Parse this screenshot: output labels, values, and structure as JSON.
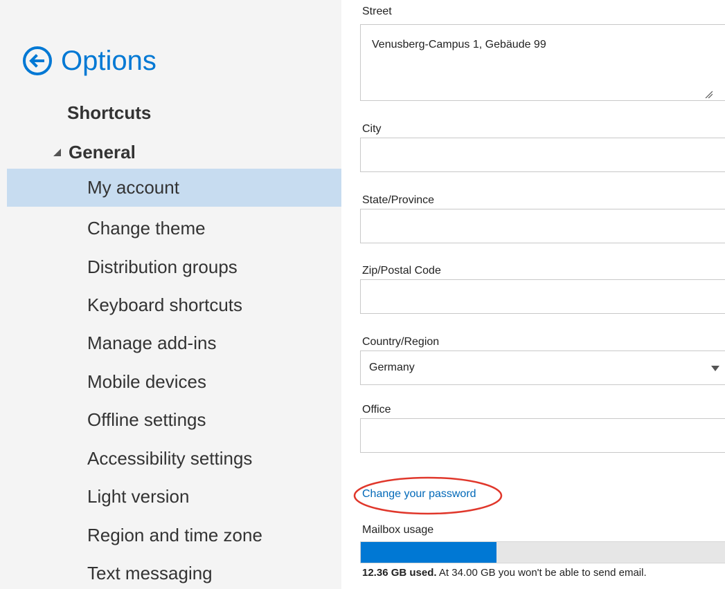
{
  "sidebar": {
    "title": "Options",
    "shortcuts": "Shortcuts",
    "general": "General",
    "items": [
      {
        "label": "My account",
        "selected": true
      },
      {
        "label": "Change theme"
      },
      {
        "label": "Distribution groups"
      },
      {
        "label": "Keyboard shortcuts"
      },
      {
        "label": "Manage add-ins"
      },
      {
        "label": "Mobile devices"
      },
      {
        "label": "Offline settings"
      },
      {
        "label": "Accessibility settings"
      },
      {
        "label": "Light version"
      },
      {
        "label": "Region and time zone"
      },
      {
        "label": "Text messaging"
      }
    ]
  },
  "form": {
    "street": {
      "label": "Street",
      "value": "Venusberg-Campus 1, Gebäude 99"
    },
    "city": {
      "label": "City",
      "value": ""
    },
    "state": {
      "label": "State/Province",
      "value": ""
    },
    "zip": {
      "label": "Zip/Postal Code",
      "value": ""
    },
    "country": {
      "label": "Country/Region",
      "value": "Germany"
    },
    "office": {
      "label": "Office",
      "value": ""
    },
    "change_password": "Change your password",
    "mailbox": {
      "label": "Mailbox usage",
      "used_text": "12.36 GB used.",
      "limit_text": "At 34.00 GB you won't be able to send email.",
      "used_fraction": 0.3635
    }
  },
  "colors": {
    "accent": "#0078d4",
    "selected_bg": "#c7dcf0",
    "annotation": "#e0372b"
  },
  "icons": [
    "back-arrow-icon",
    "collapse-triangle-icon",
    "resize-grip-icon",
    "chevron-down-icon"
  ]
}
